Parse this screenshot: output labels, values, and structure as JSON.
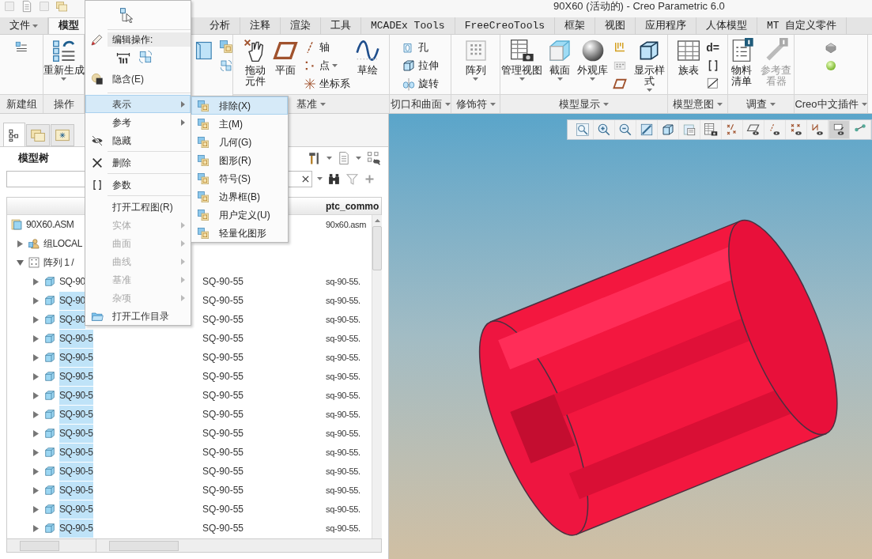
{
  "title": "90X60 (活动的) - Creo Parametric 6.0",
  "tabs": [
    {
      "label": "文件",
      "dropdown": true,
      "selected": false
    },
    {
      "label": "模型",
      "dropdown": false,
      "selected": true
    },
    {
      "label": "分析",
      "dropdown": false,
      "selected": false
    },
    {
      "label": "注释",
      "dropdown": false,
      "selected": false
    },
    {
      "label": "渲染",
      "dropdown": false,
      "selected": false
    },
    {
      "label": "工具",
      "dropdown": false,
      "selected": false
    },
    {
      "label": "MCADEx Tools",
      "dropdown": false,
      "selected": false
    },
    {
      "label": "FreeCreoTools",
      "dropdown": false,
      "selected": false
    },
    {
      "label": "框架",
      "dropdown": false,
      "selected": false
    },
    {
      "label": "视图",
      "dropdown": false,
      "selected": false
    },
    {
      "label": "应用程序",
      "dropdown": false,
      "selected": false
    },
    {
      "label": "人体模型",
      "dropdown": false,
      "selected": false
    },
    {
      "label": "MT 自定义零件",
      "dropdown": false,
      "selected": false
    }
  ],
  "ribbon_groups": [
    {
      "label": "新建组",
      "dropdown": false,
      "buttons": [
        {
          "kind": "icon"
        }
      ]
    },
    {
      "label": "操作",
      "dropdown": false,
      "buttons": [
        {
          "kind": "large",
          "label": "重新生成",
          "dropdown": true
        }
      ]
    },
    {
      "label": "基准",
      "dropdown": true,
      "buttons": [
        {
          "kind": "large",
          "label": "拖动元件"
        },
        {
          "kind": "large",
          "label": "平面"
        },
        {
          "kind": "small",
          "label": "轴"
        },
        {
          "kind": "small",
          "label": "点",
          "dropdown": true
        },
        {
          "kind": "small",
          "label": "坐标系"
        },
        {
          "kind": "large",
          "label": "草绘"
        }
      ]
    },
    {
      "label": "切口和曲面",
      "dropdown": true,
      "buttons": [
        {
          "kind": "small",
          "label": "孔"
        },
        {
          "kind": "small",
          "label": "拉伸"
        },
        {
          "kind": "small",
          "label": "旋转"
        }
      ]
    },
    {
      "label": "修饰符",
      "dropdown": true,
      "buttons": [
        {
          "kind": "large",
          "label": "阵列",
          "dropdown": true
        }
      ]
    },
    {
      "label": "模型显示",
      "dropdown": true,
      "buttons": [
        {
          "kind": "large",
          "label": "管理视图",
          "dropdown": true
        },
        {
          "kind": "large",
          "label": "截面",
          "dropdown": true
        },
        {
          "kind": "large",
          "label": "外观库",
          "dropdown": true
        },
        {
          "kind": "icon"
        },
        {
          "kind": "icon"
        },
        {
          "kind": "icon"
        },
        {
          "kind": "large",
          "label": "显示样式",
          "dropdown": true
        }
      ]
    },
    {
      "label": "模型意图",
      "dropdown": true,
      "buttons": [
        {
          "kind": "large",
          "label": "族表"
        },
        {
          "kind": "glyph",
          "label": "d="
        },
        {
          "kind": "icon"
        },
        {
          "kind": "icon"
        }
      ]
    },
    {
      "label": "调查",
      "dropdown": true,
      "buttons": [
        {
          "kind": "large",
          "label": "物料清单"
        },
        {
          "kind": "large",
          "label": "参考查看器",
          "disabled": true
        }
      ]
    },
    {
      "label": "Creo中文插件",
      "dropdown": true,
      "buttons": [
        {
          "kind": "icon"
        },
        {
          "kind": "icon"
        }
      ]
    }
  ],
  "context_menu": {
    "heading": "编辑操作:",
    "items": [
      {
        "label": "隐含(E)",
        "divider": false,
        "submenu": false,
        "disabled": false,
        "selected": false
      },
      {
        "label": "表示",
        "divider": true,
        "submenu": true,
        "disabled": false,
        "selected": true
      },
      {
        "label": "参考",
        "divider": false,
        "submenu": true,
        "disabled": false,
        "selected": false
      },
      {
        "label": "隐藏",
        "divider": false,
        "submenu": false,
        "disabled": false,
        "selected": false
      },
      {
        "label": "删除",
        "divider": true,
        "submenu": false,
        "disabled": false,
        "selected": false
      },
      {
        "label": "参数",
        "divider": true,
        "submenu": false,
        "disabled": false,
        "selected": false
      },
      {
        "label": "打开工程图(R)",
        "divider": true,
        "submenu": false,
        "disabled": false,
        "selected": false
      },
      {
        "label": "实体",
        "divider": false,
        "submenu": true,
        "disabled": true,
        "selected": false
      },
      {
        "label": "曲面",
        "divider": false,
        "submenu": true,
        "disabled": true,
        "selected": false
      },
      {
        "label": "曲线",
        "divider": false,
        "submenu": true,
        "disabled": true,
        "selected": false
      },
      {
        "label": "基准",
        "divider": false,
        "submenu": true,
        "disabled": true,
        "selected": false
      },
      {
        "label": "杂项",
        "divider": false,
        "submenu": true,
        "disabled": true,
        "selected": false
      },
      {
        "label": "打开工作目录",
        "divider": false,
        "submenu": false,
        "disabled": false,
        "selected": false
      }
    ]
  },
  "submenu": [
    {
      "label": "排除(X)",
      "selected": true
    },
    {
      "label": "主(M)",
      "selected": false
    },
    {
      "label": "几何(G)",
      "selected": false
    },
    {
      "label": "图形(R)",
      "selected": false
    },
    {
      "label": "符号(S)",
      "selected": false
    },
    {
      "label": "边界框(B)",
      "selected": false
    },
    {
      "label": "用户定义(U)",
      "selected": false
    },
    {
      "label": "轻量化图形",
      "selected": false
    }
  ],
  "model_tree": {
    "title": "模型树",
    "header": {
      "column_3": "ptc_commo"
    },
    "rows": [
      {
        "name": "90X60.ASM",
        "column_3": "90x60.asm",
        "selected": false,
        "children": [
          {
            "name": "组LOCAL",
            "expanded": false,
            "selected": false
          },
          {
            "name": "阵列 1 /",
            "expanded": true,
            "selected": false,
            "children": [
              {
                "name": "SQ-90",
                "column_2": "SQ-90-55",
                "column_3": "sq-90-55.",
                "expanded": false,
                "selected": false
              },
              {
                "name": "SQ-90",
                "column_2": "SQ-90-55",
                "column_3": "sq-90-55.",
                "expanded": false,
                "selected": true
              },
              {
                "name": "SQ-90",
                "column_2": "SQ-90-55",
                "column_3": "sq-90-55.",
                "expanded": false,
                "selected": true
              },
              {
                "name": "SQ-90-5",
                "column_2": "SQ-90-55",
                "column_3": "sq-90-55.",
                "expanded": false,
                "selected": true
              },
              {
                "name": "SQ-90-5",
                "column_2": "SQ-90-55",
                "column_3": "sq-90-55.",
                "expanded": false,
                "selected": true
              },
              {
                "name": "SQ-90-5",
                "column_2": "SQ-90-55",
                "column_3": "sq-90-55.",
                "expanded": false,
                "selected": true
              },
              {
                "name": "SQ-90-5",
                "column_2": "SQ-90-55",
                "column_3": "sq-90-55.",
                "expanded": false,
                "selected": true
              },
              {
                "name": "SQ-90-5",
                "column_2": "SQ-90-55",
                "column_3": "sq-90-55.",
                "expanded": false,
                "selected": true
              },
              {
                "name": "SQ-90-5",
                "column_2": "SQ-90-55",
                "column_3": "sq-90-55.",
                "expanded": false,
                "selected": true
              },
              {
                "name": "SQ-90-5",
                "column_2": "SQ-90-55",
                "column_3": "sq-90-55.",
                "expanded": false,
                "selected": true
              },
              {
                "name": "SQ-90-5",
                "column_2": "SQ-90-55",
                "column_3": "sq-90-55.",
                "expanded": false,
                "selected": true
              },
              {
                "name": "SQ-90-5",
                "column_2": "SQ-90-55",
                "column_3": "sq-90-55.",
                "expanded": false,
                "selected": true
              },
              {
                "name": "SQ-90-5",
                "column_2": "SQ-90-55",
                "column_3": "sq-90-55.",
                "expanded": false,
                "selected": true
              },
              {
                "name": "SQ-90-5",
                "column_2": "SQ-90-55",
                "column_3": "sq-90-55.",
                "expanded": false,
                "selected": true
              }
            ]
          }
        ]
      }
    ]
  },
  "view_toolbar": [
    {
      "selected": false
    },
    {
      "selected": false
    },
    {
      "selected": false
    },
    {
      "selected": false
    },
    {
      "selected": false
    },
    {
      "selected": false
    },
    {
      "selected": false
    },
    {
      "selected": false
    },
    {
      "selected": false
    },
    {
      "selected": false
    },
    {
      "selected": false
    },
    {
      "selected": false
    },
    {
      "selected": true
    },
    {
      "selected": false
    }
  ]
}
